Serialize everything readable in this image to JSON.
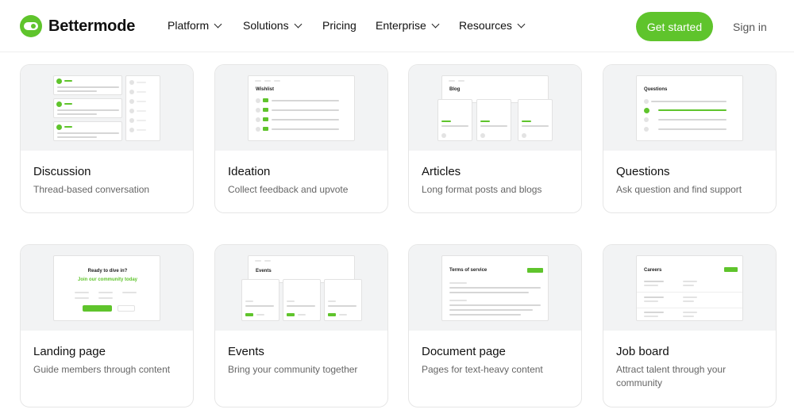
{
  "brand": {
    "name": "Bettermode",
    "accent": "#5fc42c"
  },
  "nav": {
    "items": [
      {
        "label": "Platform",
        "dropdown": true
      },
      {
        "label": "Solutions",
        "dropdown": true
      },
      {
        "label": "Pricing",
        "dropdown": false
      },
      {
        "label": "Enterprise",
        "dropdown": true
      },
      {
        "label": "Resources",
        "dropdown": true
      }
    ],
    "cta": "Get started",
    "signin": "Sign in"
  },
  "cards": [
    {
      "title": "Discussion",
      "desc": "Thread-based conversation",
      "preview_title": ""
    },
    {
      "title": "Ideation",
      "desc": "Collect feedback and upvote",
      "preview_title": "Wishlist"
    },
    {
      "title": "Articles",
      "desc": "Long format posts and blogs",
      "preview_title": "Blog"
    },
    {
      "title": "Questions",
      "desc": "Ask question and find support",
      "preview_title": "Questions"
    },
    {
      "title": "Landing page",
      "desc": "Guide members through content",
      "preview_title": "Ready to dive in?",
      "preview_subtitle": "Join our community today"
    },
    {
      "title": "Events",
      "desc": "Bring your community together",
      "preview_title": "Events"
    },
    {
      "title": "Document page",
      "desc": "Pages for text-heavy content",
      "preview_title": "Terms of service"
    },
    {
      "title": "Job board",
      "desc": "Attract talent through your community",
      "preview_title": "Careers"
    }
  ]
}
